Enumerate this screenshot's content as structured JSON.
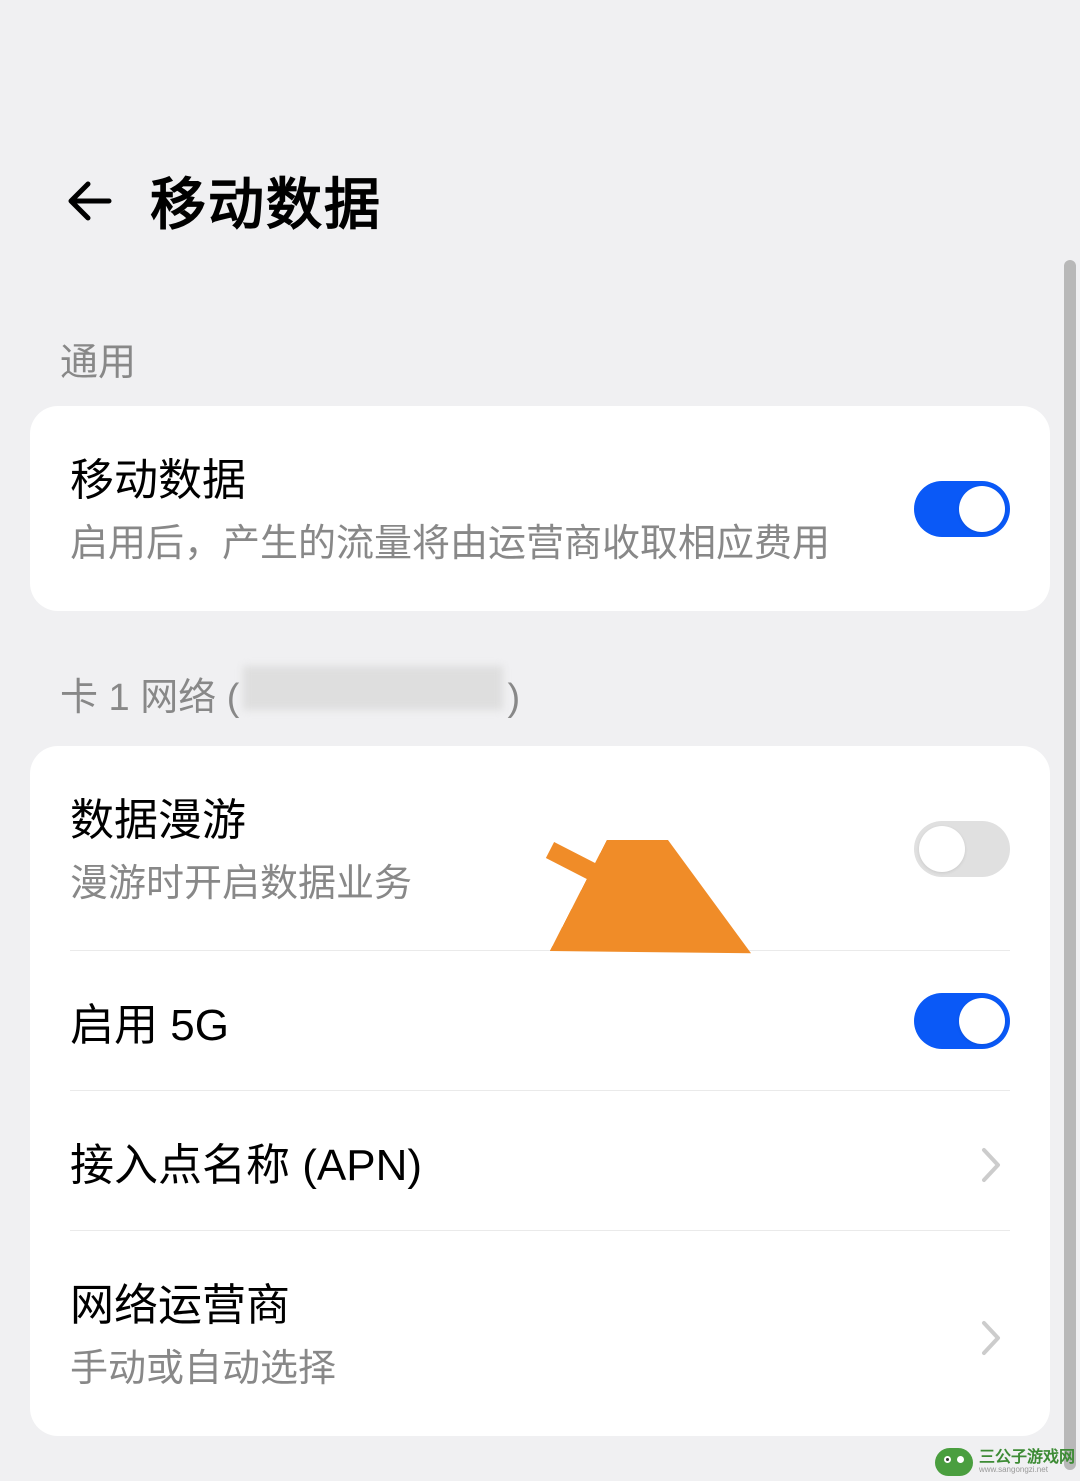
{
  "header": {
    "title": "移动数据"
  },
  "general_section": {
    "label": "通用",
    "mobile_data": {
      "title": "移动数据",
      "desc": "启用后，产生的流量将由运营商收取相应费用",
      "enabled": true
    }
  },
  "sim1_section": {
    "label_prefix": "卡 1 网络 (",
    "label_suffix": ")",
    "data_roaming": {
      "title": "数据漫游",
      "desc": "漫游时开启数据业务",
      "enabled": false
    },
    "enable_5g": {
      "title": "启用 5G",
      "enabled": true
    },
    "apn": {
      "title": "接入点名称 (APN)"
    },
    "carrier": {
      "title": "网络运营商",
      "desc": "手动或自动选择"
    }
  },
  "watermark": {
    "name": "三公子游戏网",
    "url": "www.sangongzi.net"
  }
}
